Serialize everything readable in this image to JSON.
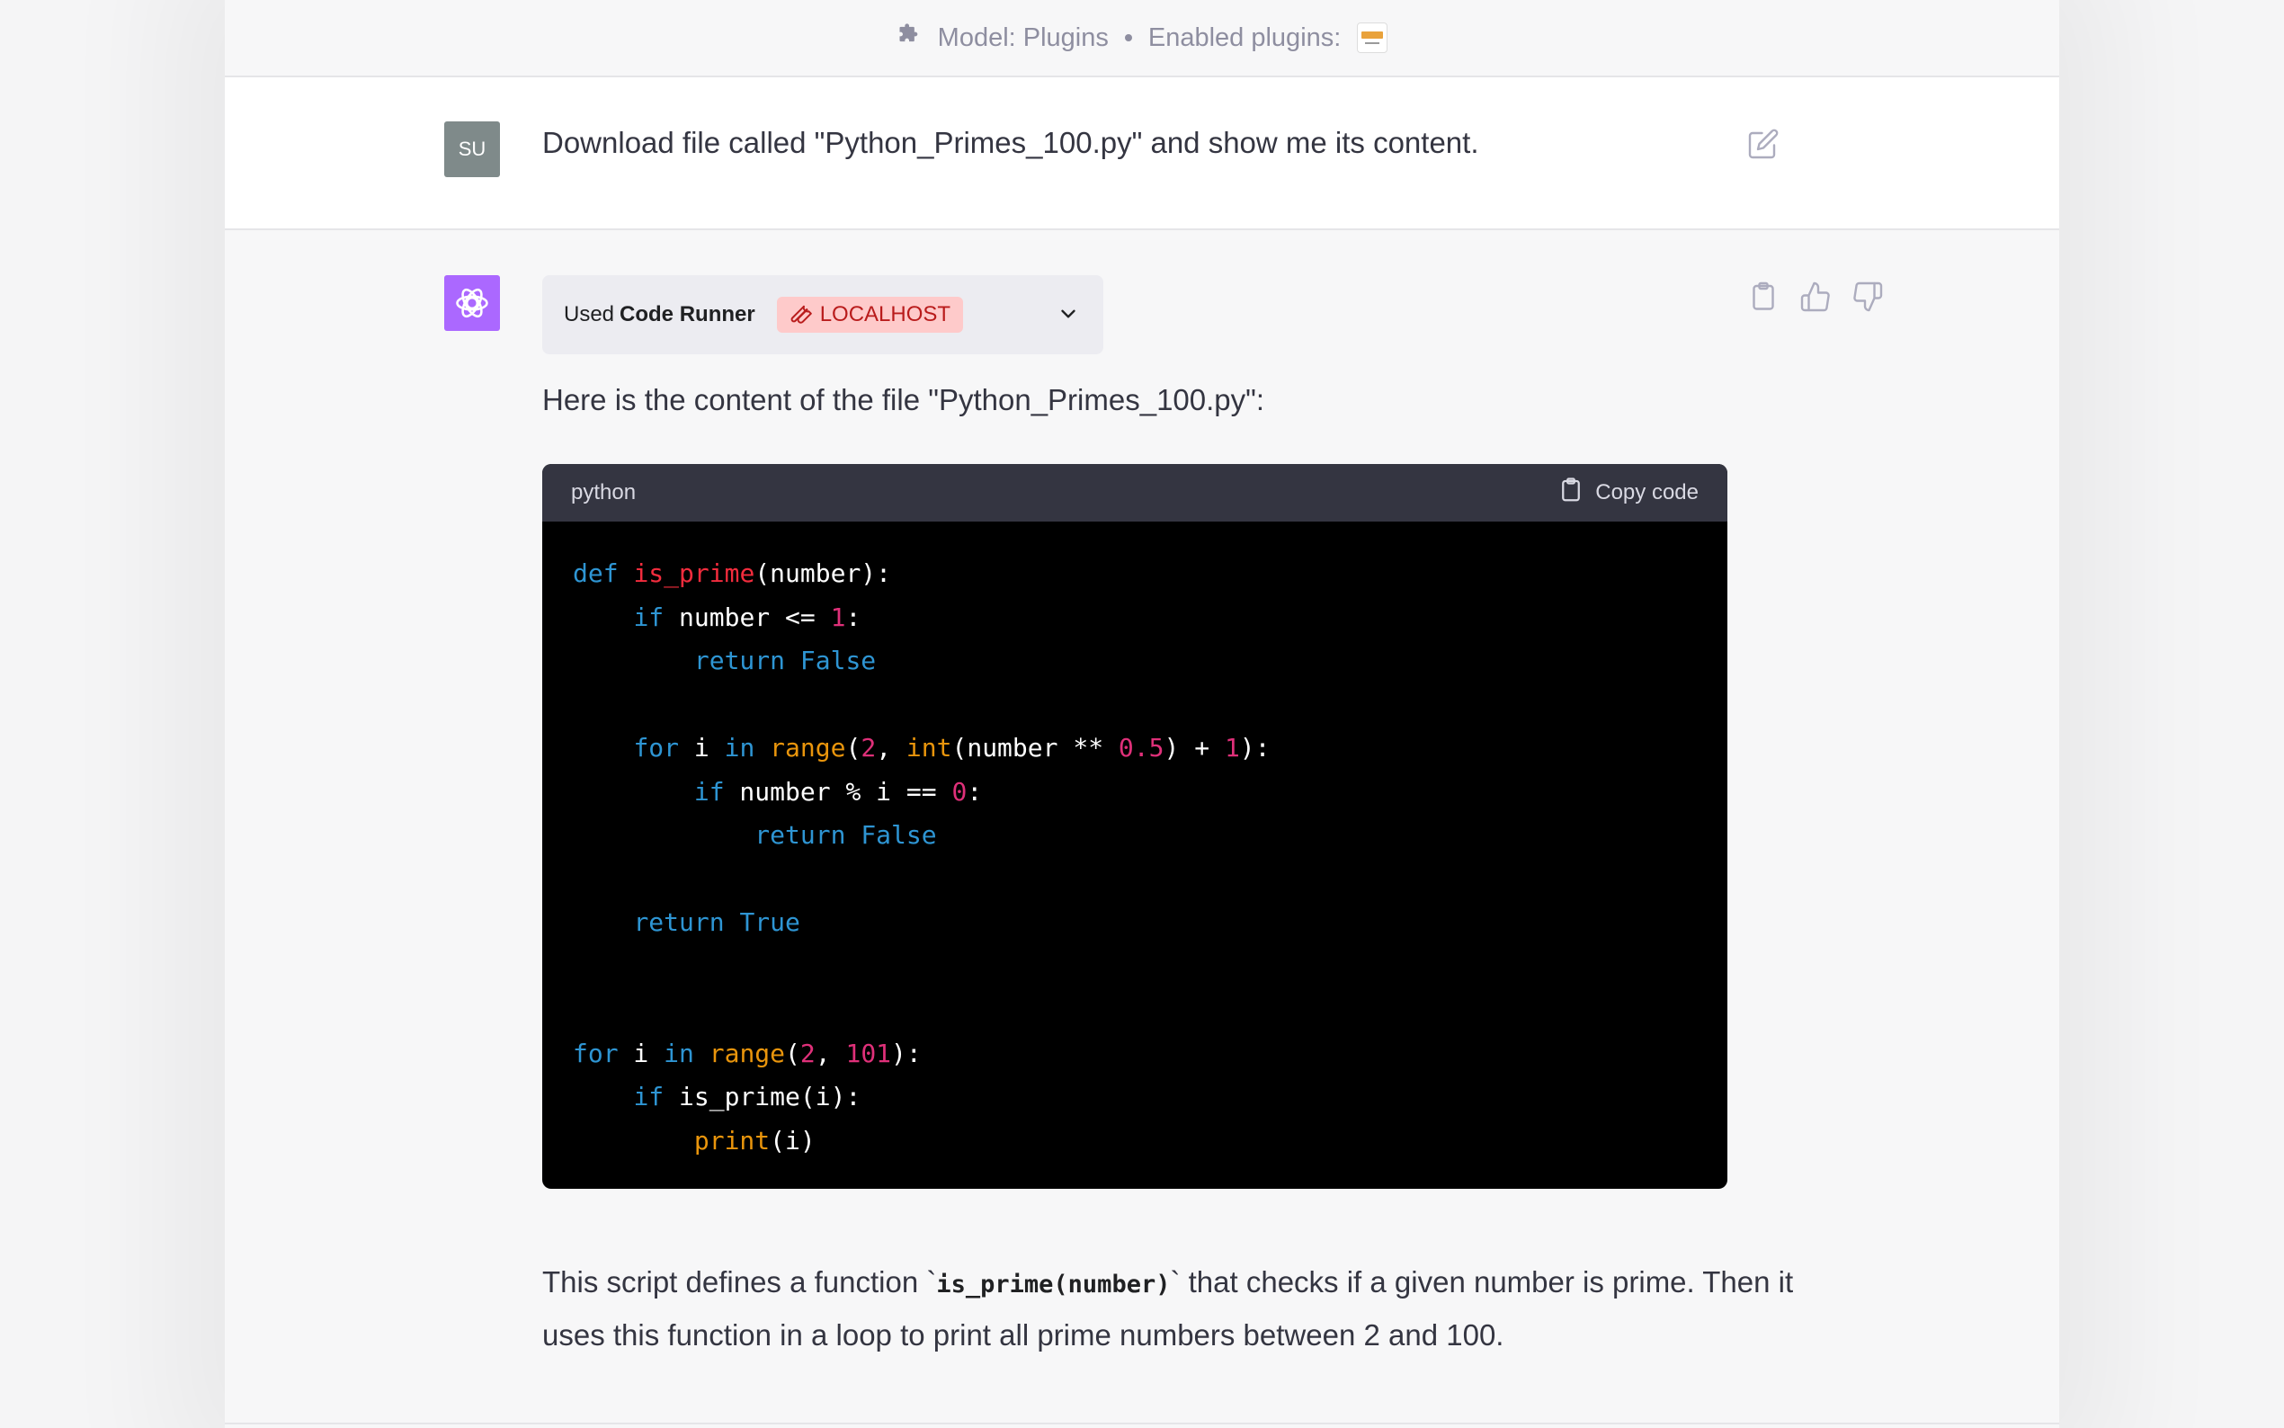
{
  "header": {
    "model_label": "Model: Plugins",
    "enabled_label": "Enabled plugins:"
  },
  "user_message": {
    "avatar_initials": "SU",
    "text": "Download file called \"Python_Primes_100.py\" and show me its content."
  },
  "assistant": {
    "plugin_used_prefix": "Used",
    "plugin_name": "Code Runner",
    "plugin_badge": "LOCALHOST",
    "intro": "Here is the content of the file \"Python_Primes_100.py\":",
    "code_language": "python",
    "copy_label": "Copy code",
    "code_lines": [
      "def is_prime(number):",
      "    if number <= 1:",
      "        return False",
      "",
      "    for i in range(2, int(number ** 0.5) + 1):",
      "        if number % i == 0:",
      "            return False",
      "",
      "    return True",
      "",
      "",
      "for i in range(2, 101):",
      "    if is_prime(i):",
      "        print(i)"
    ],
    "outro_before_code": "This script defines a function `",
    "outro_code": "is_prime(number)",
    "outro_after_code": "` that checks if a given number is prime. Then it uses this function in a loop to print all prime numbers between 2 and 100."
  },
  "colors": {
    "keyword": "#2e95d3",
    "function": "#f22c3d",
    "builtin": "#e9950c",
    "number": "#df3079",
    "gpt_avatar": "#ab68ff",
    "badge_bg": "#fecaca"
  },
  "icons": [
    "puzzle-icon",
    "edit-icon",
    "openai-logo-icon",
    "wrench-icon",
    "chevron-down-icon",
    "clipboard-icon",
    "thumbs-up-icon",
    "thumbs-down-icon"
  ]
}
